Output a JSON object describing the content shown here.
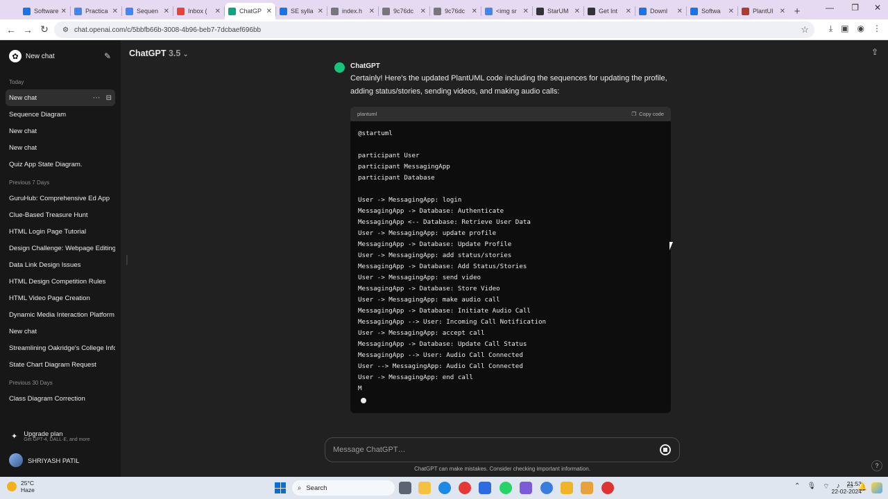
{
  "browser": {
    "tabs": [
      {
        "title": "Software",
        "color": "#1a73e8",
        "active": false
      },
      {
        "title": "Practica",
        "color": "#4285f4",
        "active": false
      },
      {
        "title": "Sequen",
        "color": "#4285f4",
        "active": false
      },
      {
        "title": "Inbox (",
        "color": "#ea4335",
        "active": false
      },
      {
        "title": "ChatGP",
        "color": "#10a37f",
        "active": true
      },
      {
        "title": "SE sylla",
        "color": "#1a73e8",
        "active": false
      },
      {
        "title": "index.h",
        "color": "#777777",
        "active": false
      },
      {
        "title": "9c76dc",
        "color": "#777777",
        "active": false
      },
      {
        "title": "9c76dc",
        "color": "#777777",
        "active": false
      },
      {
        "title": "<img sr",
        "color": "#4285f4",
        "active": false
      },
      {
        "title": "StarUM",
        "color": "#333333",
        "active": false
      },
      {
        "title": "Get Int",
        "color": "#333333",
        "active": false
      },
      {
        "title": "Downl",
        "color": "#1a73e8",
        "active": false
      },
      {
        "title": "Softwa",
        "color": "#1a73e8",
        "active": false
      },
      {
        "title": "PlantUI",
        "color": "#b03a2e",
        "active": false
      }
    ],
    "url": "chat.openai.com/c/5bbfb66b-3008-4b96-beb7-7dcbaef696bb"
  },
  "sidebar": {
    "new_chat_label": "New chat",
    "groups": [
      {
        "label": "Today",
        "items": [
          "New chat",
          "Sequence Diagram",
          "New chat",
          "New chat",
          "Quiz App State Diagram."
        ]
      },
      {
        "label": "Previous 7 Days",
        "items": [
          "GuruHub: Comprehensive Ed App",
          "Clue-Based Treasure Hunt",
          "HTML Login Page Tutorial",
          "Design Challenge: Webpage Editing",
          "Data Link Design Issues",
          "HTML Design Competition Rules",
          "HTML Video Page Creation",
          "Dynamic Media Interaction Platform",
          "New chat",
          "Streamlining Oakridge's College Info",
          "State Chart Diagram Request"
        ]
      },
      {
        "label": "Previous 30 Days",
        "items": [
          "Class Diagram Correction"
        ]
      }
    ],
    "upgrade_title": "Upgrade plan",
    "upgrade_sub": "Get GPT-4, DALL·E, and more",
    "user_name": "SHRIYASH PATIL"
  },
  "main": {
    "model": "ChatGPT",
    "model_version": "3.5",
    "bot_name": "ChatGPT",
    "message": "Certainly! Here's the updated PlantUML code including the sequences for updating the profile, adding status/stories, sending videos, and making audio calls:",
    "code_lang": "plantuml",
    "copy_label": "Copy code",
    "code": "@startuml\n\nparticipant User\nparticipant MessagingApp\nparticipant Database\n\nUser -> MessagingApp: login\nMessagingApp -> Database: Authenticate\nMessagingApp <-- Database: Retrieve User Data\nUser -> MessagingApp: update profile\nMessagingApp -> Database: Update Profile\nUser -> MessagingApp: add status/stories\nMessagingApp -> Database: Add Status/Stories\nUser -> MessagingApp: send video\nMessagingApp -> Database: Store Video\nUser -> MessagingApp: make audio call\nMessagingApp -> Database: Initiate Audio Call\nMessagingApp --> User: Incoming Call Notification\nUser -> MessagingApp: accept call\nMessagingApp -> Database: Update Call Status\nMessagingApp --> User: Audio Call Connected\nUser --> MessagingApp: Audio Call Connected\nUser -> MessagingApp: end call\nM",
    "composer_placeholder": "Message ChatGPT…",
    "disclaimer": "ChatGPT can make mistakes. Consider checking important information.",
    "help": "?"
  },
  "taskbar": {
    "temp": "25°C",
    "weather": "Haze",
    "search": "Search",
    "time": "21:53",
    "date": "22-02-2024"
  }
}
